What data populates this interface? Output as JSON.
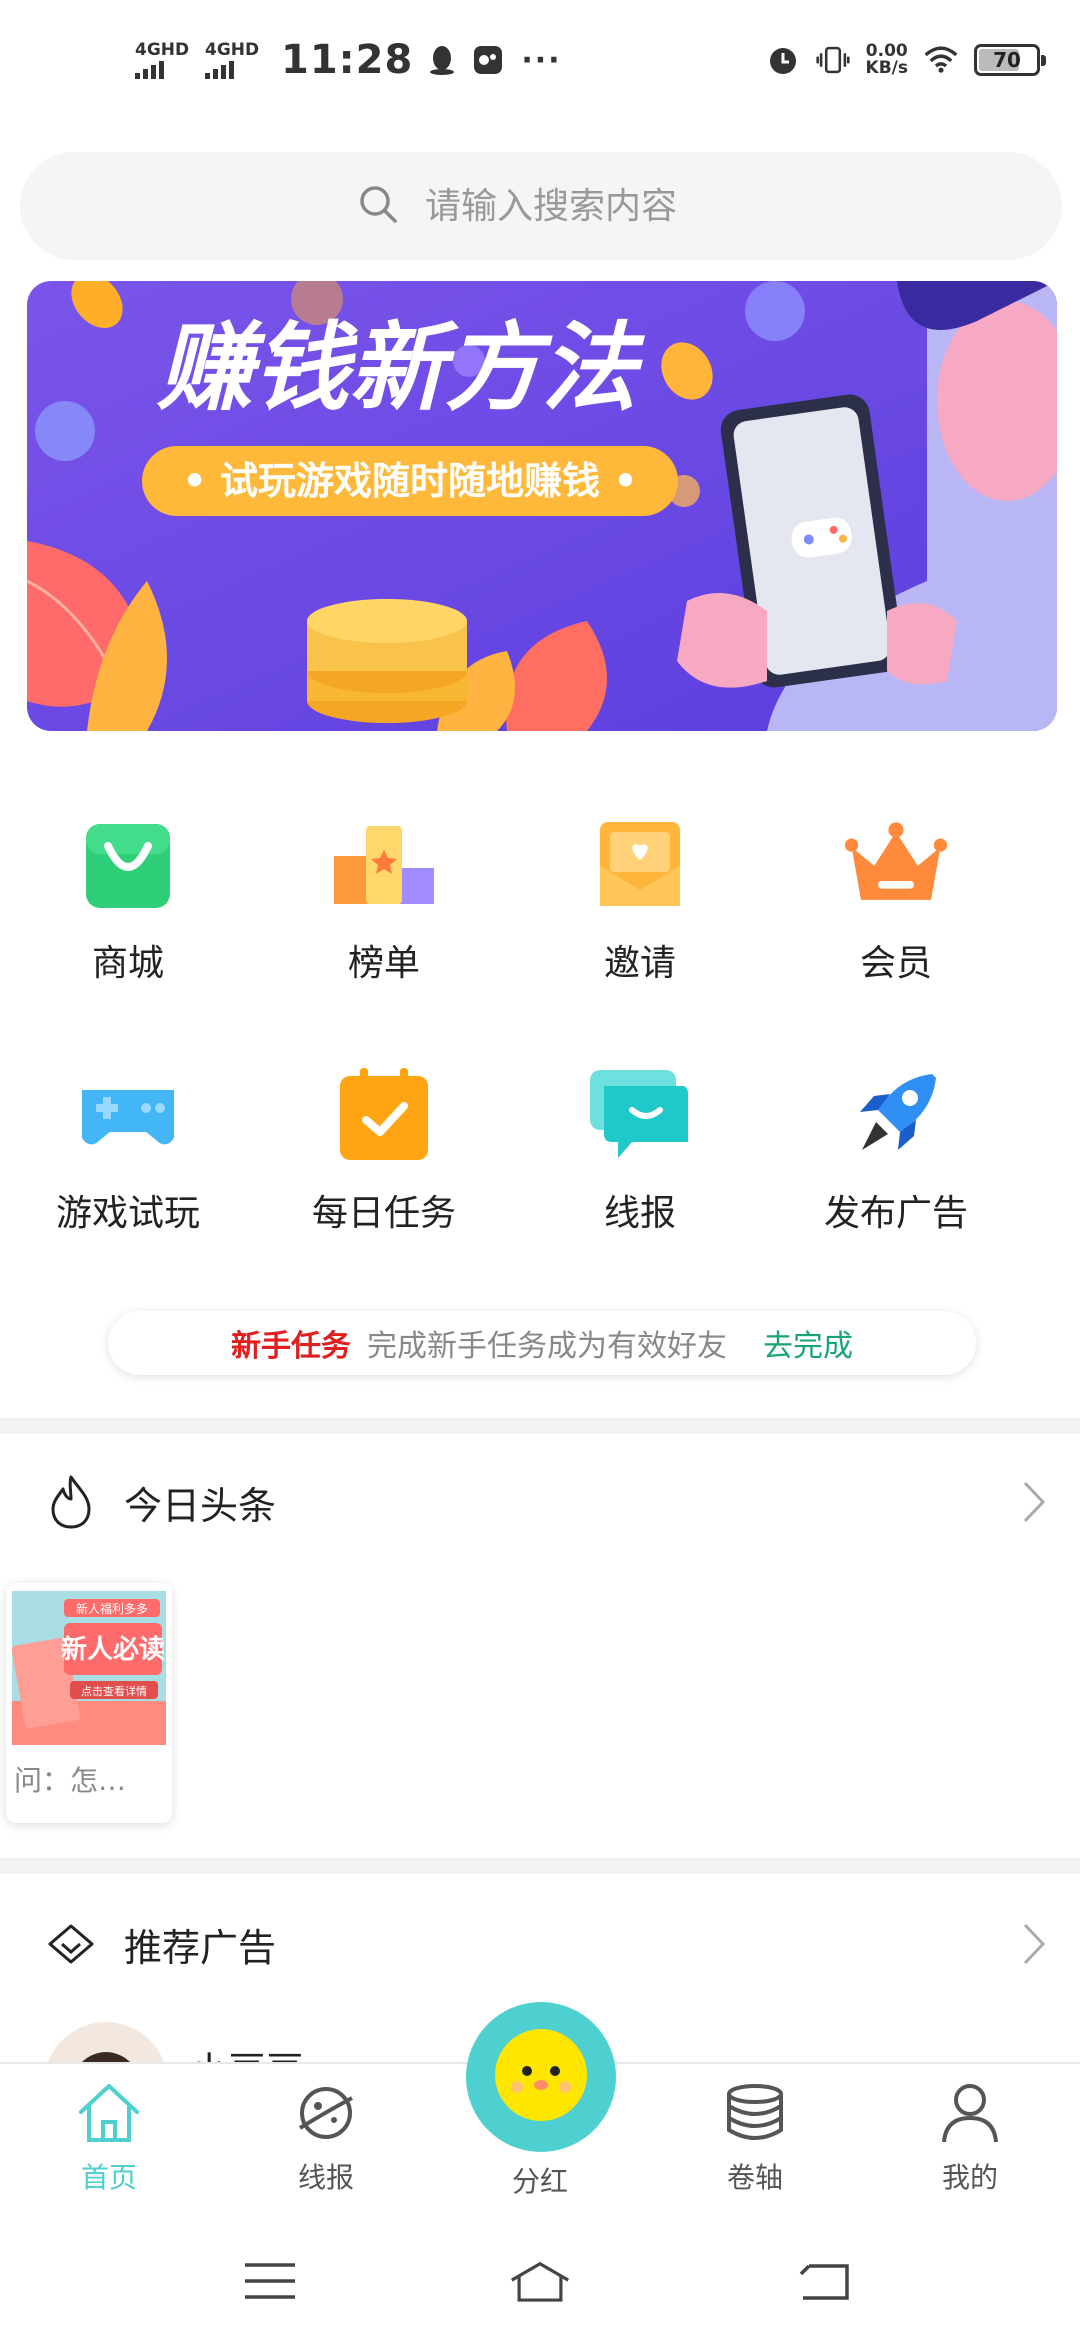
{
  "status_bar": {
    "network_1": "4GHD",
    "network_2": "4GHD",
    "time": "11:28",
    "more": "···",
    "speed_value": "0.00",
    "speed_unit": "KB/s",
    "battery": "70"
  },
  "search": {
    "placeholder": "请输入搜索内容"
  },
  "banner": {
    "headline": "赚钱新方法",
    "tagline": "• 试玩游戏随时随地赚钱 •"
  },
  "grid": {
    "items": [
      {
        "label": "商城",
        "icon": "shopping-bag-icon"
      },
      {
        "label": "榜单",
        "icon": "ranking-podium-icon"
      },
      {
        "label": "邀请",
        "icon": "invite-envelope-icon"
      },
      {
        "label": "会员",
        "icon": "crown-icon"
      },
      {
        "label": "游戏试玩",
        "icon": "gamepad-icon"
      },
      {
        "label": "每日任务",
        "icon": "calendar-check-icon"
      },
      {
        "label": "线报",
        "icon": "chat-bubble-icon"
      },
      {
        "label": "发布广告",
        "icon": "rocket-icon"
      }
    ]
  },
  "newbie": {
    "title": "新手任务",
    "desc": "完成新手任务成为有效好友",
    "action": "去完成"
  },
  "headlines": {
    "title": "今日头条",
    "card_caption": "问：怎…",
    "thumb_title": "新人必读",
    "thumb_top": "新人福利多多",
    "thumb_sub": "点击查看详情"
  },
  "recommend": {
    "title": "推荐广告",
    "first_name": "小豆豆"
  },
  "tabbar": {
    "tabs": [
      {
        "label": "首页",
        "icon": "home-icon"
      },
      {
        "label": "线报",
        "icon": "planet-icon"
      },
      {
        "label": "分红",
        "icon": "chick-face-icon"
      },
      {
        "label": "卷轴",
        "icon": "coin-stack-icon"
      },
      {
        "label": "我的",
        "icon": "person-icon"
      }
    ],
    "active_color": "#4ecfd0"
  },
  "colors": {
    "accent": "#4ecfd0",
    "banner_bg": "#6b4ee6",
    "newbie_red": "#e02020",
    "newbie_green": "#1aa37a"
  }
}
